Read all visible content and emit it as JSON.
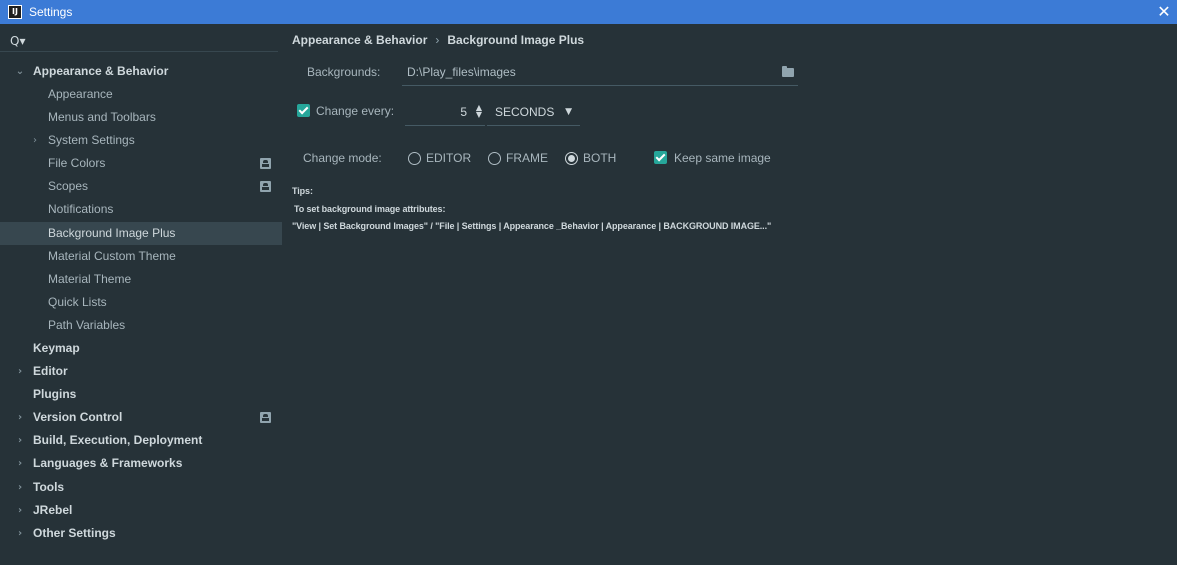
{
  "window": {
    "title": "Settings",
    "app_icon_text": "IJ",
    "close_glyph": "✕"
  },
  "sidebar": {
    "search_glyph": "Q▾",
    "items": [
      {
        "label": "Appearance & Behavior",
        "expanded": true
      },
      {
        "label": "Appearance"
      },
      {
        "label": "Menus and Toolbars"
      },
      {
        "label": "System Settings"
      },
      {
        "label": "File Colors"
      },
      {
        "label": "Scopes"
      },
      {
        "label": "Notifications"
      },
      {
        "label": "Background Image Plus",
        "selected": true
      },
      {
        "label": "Material Custom Theme"
      },
      {
        "label": "Material Theme"
      },
      {
        "label": "Quick Lists"
      },
      {
        "label": "Path Variables"
      },
      {
        "label": "Keymap"
      },
      {
        "label": "Editor"
      },
      {
        "label": "Plugins"
      },
      {
        "label": "Version Control"
      },
      {
        "label": "Build, Execution, Deployment"
      },
      {
        "label": "Languages & Frameworks"
      },
      {
        "label": "Tools"
      },
      {
        "label": "JRebel"
      },
      {
        "label": "Other Settings"
      }
    ]
  },
  "main": {
    "breadcrumb": {
      "parent": "Appearance & Behavior",
      "separator": "›",
      "current": "Background Image Plus"
    },
    "backgrounds": {
      "label": "Backgrounds:",
      "value": "D:\\Play_files\\images"
    },
    "change_every": {
      "label": "Change every:",
      "checked": true,
      "value": "5",
      "unit": "SECONDS"
    },
    "change_mode": {
      "label": "Change mode:",
      "options": [
        "EDITOR",
        "FRAME",
        "BOTH"
      ],
      "selected": "BOTH"
    },
    "keep_same_image": {
      "label": "Keep same image",
      "checked": true
    },
    "tips": {
      "heading": "Tips:",
      "line1": "To set background image attributes:",
      "line2": "\"View | Set Background Images\" / \"File | Settings | Appearance _Behavior | Appearance | BACKGROUND IMAGE...\""
    }
  },
  "colors": {
    "background": "#263238",
    "titlebar": "#3c7bd6",
    "selection": "#37474f",
    "accent": "#26a69a"
  }
}
